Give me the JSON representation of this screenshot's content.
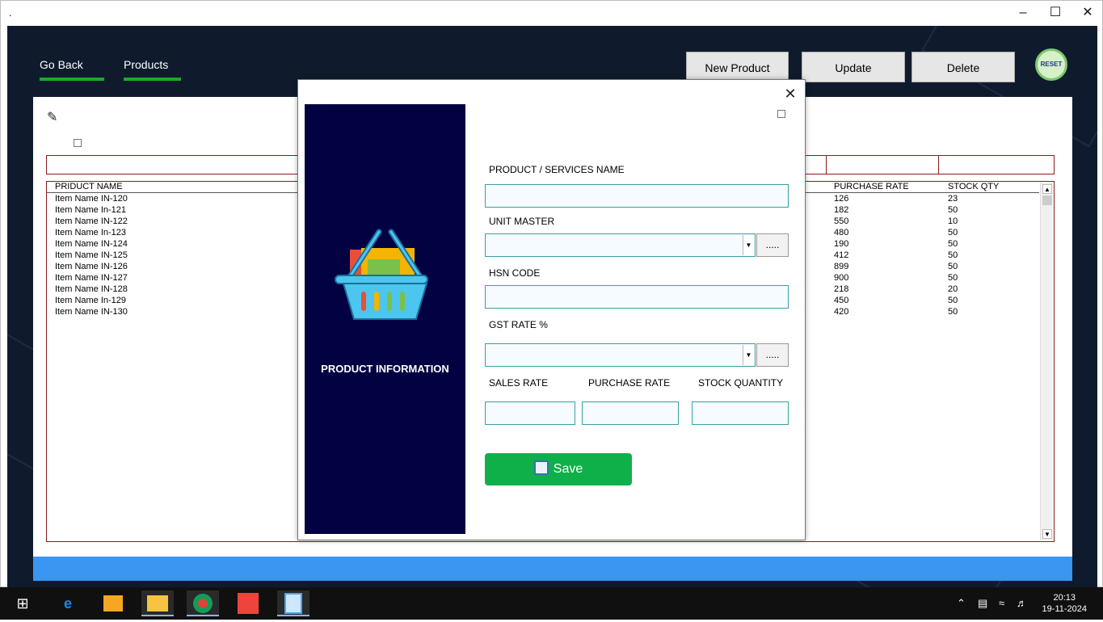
{
  "window": {
    "title": "."
  },
  "nav": {
    "go_back": "Go Back",
    "products": "Products"
  },
  "toolbar": {
    "new_product": "New Product",
    "update": "Update",
    "delete": "Delete",
    "reset": "RESET"
  },
  "list": {
    "headers": {
      "name": "PRIDUCT NAME",
      "purchase_rate": "PURCHASE RATE",
      "stock_qty": "STOCK QTY"
    },
    "rows": [
      {
        "name": "Item Name IN-120",
        "purchase_rate": "126",
        "stock_qty": "23"
      },
      {
        "name": "Item Name In-121",
        "purchase_rate": "182",
        "stock_qty": "50"
      },
      {
        "name": "Item Name IN-122",
        "purchase_rate": "550",
        "stock_qty": "10"
      },
      {
        "name": "Item Name In-123",
        "purchase_rate": "480",
        "stock_qty": "50"
      },
      {
        "name": "Item Name IN-124",
        "purchase_rate": "190",
        "stock_qty": "50"
      },
      {
        "name": "Item Name IN-125",
        "purchase_rate": "412",
        "stock_qty": "50"
      },
      {
        "name": "Item Name IN-126",
        "purchase_rate": "899",
        "stock_qty": "50"
      },
      {
        "name": "Item Name IN-127",
        "purchase_rate": "900",
        "stock_qty": "50"
      },
      {
        "name": "Item Name IN-128",
        "purchase_rate": "218",
        "stock_qty": "20"
      },
      {
        "name": "Item Name In-129",
        "purchase_rate": "450",
        "stock_qty": "50"
      },
      {
        "name": "Item Name IN-130",
        "purchase_rate": "420",
        "stock_qty": "50"
      }
    ]
  },
  "dialog": {
    "side_title": "PRODUCT INFORMATION",
    "labels": {
      "name": "PRODUCT / SERVICES NAME",
      "unit": "UNIT MASTER",
      "hsn": "HSN CODE",
      "gst": "GST RATE %",
      "sales_rate": "SALES RATE",
      "purchase_rate": "PURCHASE RATE",
      "stock_qty": "STOCK QUANTITY"
    },
    "values": {
      "name": "",
      "unit": "",
      "hsn": "",
      "gst": "",
      "sales_rate": "",
      "purchase_rate": "",
      "stock_qty": ""
    },
    "ellipsis": ".....",
    "save": "Save"
  },
  "taskbar": {
    "time": "20:13",
    "date": "19-11-2024"
  },
  "colors": {
    "app_bg": "#0f1b2d",
    "nav_underline": "#1aaa2a",
    "side_panel": "#020242",
    "save": "#0fb04a",
    "status_bar": "#3a96f0",
    "grid_border": "#8a1a1a"
  }
}
